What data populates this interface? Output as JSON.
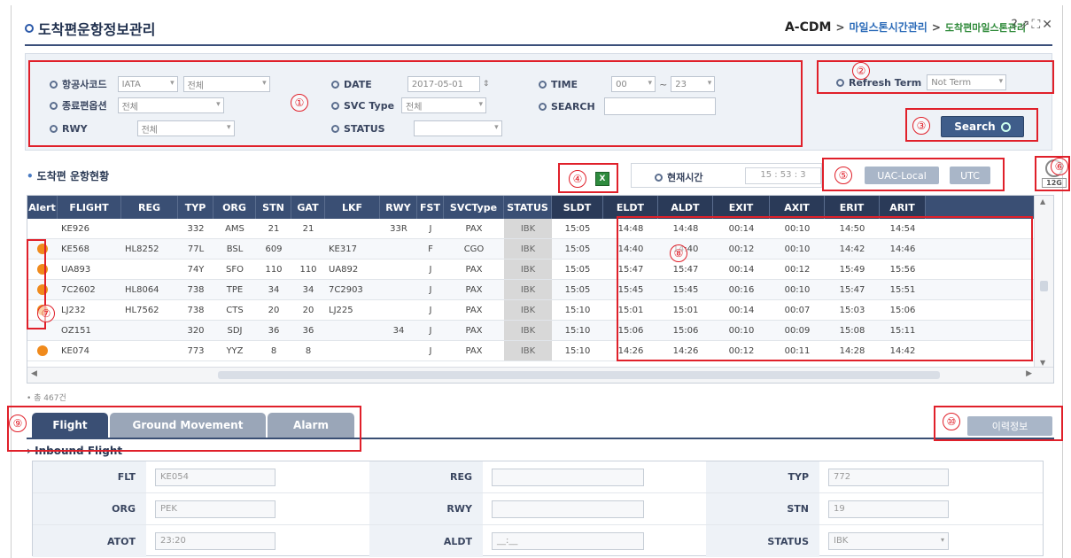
{
  "header": {
    "title": "도착편운항정보관리",
    "crumb_root": "A-CDM",
    "crumb_mid": "마일스톤시간관리",
    "crumb_leaf": "도착편마일스톤관리",
    "separator": ">",
    "icons": [
      "help-icon",
      "popout-icon",
      "fullscreen-icon",
      "close-icon"
    ],
    "icon_glyphs": [
      "?",
      "⇗",
      "⛶",
      "✕"
    ]
  },
  "search": {
    "airline_label": "항공사코드",
    "airline_code_type": "IATA",
    "airline_value": "전체",
    "date_label": "DATE",
    "date_value": "2017-05-01",
    "time_label": "TIME",
    "time_from": "00",
    "time_sep": "~",
    "time_to": "23",
    "refresh_label": "Refresh Term",
    "refresh_value": "Not Term",
    "end_option_label": "종료편옵션",
    "end_option_value": "전체",
    "svc_type_label": "SVC Type",
    "svc_type_value": "전체",
    "search_label": "SEARCH",
    "search_value": "",
    "rwy_label": "RWY",
    "rwy_value": "전체",
    "status_label": "STATUS",
    "status_value": "",
    "search_button": "Search"
  },
  "status_section": {
    "title": "도착편 운항현황",
    "excel_icon": "excel-icon",
    "current_time_label": "현재시간",
    "current_time_value": "15 : 53 : 3",
    "local_button": "UAC-Local",
    "utc_button": "UTC",
    "clock_badge": "12G"
  },
  "annotations": [
    "①",
    "②",
    "③",
    "④",
    "⑤",
    "⑥",
    "⑦",
    "⑧",
    "⑨",
    "⑩"
  ],
  "table": {
    "headers": [
      "Alert",
      "FLIGHT",
      "REG",
      "TYP",
      "ORG",
      "STN",
      "GAT",
      "LKF",
      "RWY",
      "FST",
      "SVCType",
      "STATUS",
      "SLDT",
      "ELDT",
      "ALDT",
      "EXIT",
      "AXIT",
      "ERIT",
      "ARIT"
    ],
    "rows": [
      {
        "alert": false,
        "flight": "KE926",
        "reg": "",
        "typ": "332",
        "org": "AMS",
        "stn": "21",
        "gat": "21",
        "lkf": "",
        "rwy": "33R",
        "fst": "J",
        "svc": "PAX",
        "status": "IBK",
        "sldt": "15:05",
        "eldt": "14:48",
        "aldt": "14:48",
        "exit": "00:14",
        "axit": "00:10",
        "erit": "14:50",
        "arit": "14:54"
      },
      {
        "alert": true,
        "flight": "KE568",
        "reg": "HL8252",
        "typ": "77L",
        "org": "BSL",
        "stn": "609",
        "gat": "",
        "lkf": "KE317",
        "rwy": "",
        "fst": "F",
        "svc": "CGO",
        "status": "IBK",
        "sldt": "15:05",
        "eldt": "14:40",
        "aldt": "14:40",
        "exit": "00:12",
        "axit": "00:10",
        "erit": "14:42",
        "arit": "14:46"
      },
      {
        "alert": true,
        "flight": "UA893",
        "reg": "",
        "typ": "74Y",
        "org": "SFO",
        "stn": "110",
        "gat": "110",
        "lkf": "UA892",
        "rwy": "",
        "fst": "J",
        "svc": "PAX",
        "status": "IBK",
        "sldt": "15:05",
        "eldt": "15:47",
        "aldt": "15:47",
        "exit": "00:14",
        "axit": "00:12",
        "erit": "15:49",
        "arit": "15:56"
      },
      {
        "alert": true,
        "flight": "7C2602",
        "reg": "HL8064",
        "typ": "738",
        "org": "TPE",
        "stn": "34",
        "gat": "34",
        "lkf": "7C2903",
        "rwy": "",
        "fst": "J",
        "svc": "PAX",
        "status": "IBK",
        "sldt": "15:05",
        "eldt": "15:45",
        "aldt": "15:45",
        "exit": "00:16",
        "axit": "00:10",
        "erit": "15:47",
        "arit": "15:51"
      },
      {
        "alert": true,
        "flight": "LJ232",
        "reg": "HL7562",
        "typ": "738",
        "org": "CTS",
        "stn": "20",
        "gat": "20",
        "lkf": "LJ225",
        "rwy": "",
        "fst": "J",
        "svc": "PAX",
        "status": "IBK",
        "sldt": "15:10",
        "eldt": "15:01",
        "aldt": "15:01",
        "exit": "00:14",
        "axit": "00:07",
        "erit": "15:03",
        "arit": "15:06"
      },
      {
        "alert": false,
        "flight": "OZ151",
        "reg": "",
        "typ": "320",
        "org": "SDJ",
        "stn": "36",
        "gat": "36",
        "lkf": "",
        "rwy": "34",
        "fst": "J",
        "svc": "PAX",
        "status": "IBK",
        "sldt": "15:10",
        "eldt": "15:06",
        "aldt": "15:06",
        "exit": "00:10",
        "axit": "00:09",
        "erit": "15:08",
        "arit": "15:11"
      },
      {
        "alert": true,
        "flight": "KE074",
        "reg": "",
        "typ": "773",
        "org": "YYZ",
        "stn": "8",
        "gat": "8",
        "lkf": "",
        "rwy": "",
        "fst": "J",
        "svc": "PAX",
        "status": "IBK",
        "sldt": "15:10",
        "eldt": "14:26",
        "aldt": "14:26",
        "exit": "00:12",
        "axit": "00:11",
        "erit": "14:28",
        "arit": "14:42"
      }
    ],
    "total": "• 총 467건"
  },
  "tabs": {
    "items": [
      "Flight",
      "Ground Movement",
      "Alarm"
    ],
    "active": "Flight",
    "info_button": "이력정보"
  },
  "inbound": {
    "title": "Inbound Flight",
    "flt_label": "FLT",
    "flt_value": "KE054",
    "reg_label": "REG",
    "reg_value": "",
    "typ_label": "TYP",
    "typ_value": "772",
    "org_label": "ORG",
    "org_value": "PEK",
    "rwy_label": "RWY",
    "rwy_value": "",
    "stn_label": "STN",
    "stn_value": "19",
    "atot_label": "ATOT",
    "atot_value": "23:20",
    "aldt_label": "ALDT",
    "aldt_value": "__:__",
    "status_label": "STATUS",
    "status_value": "IBK"
  },
  "colors": {
    "header_bg": "#3a4f74",
    "annotation_red": "#e0202a",
    "alert_orange": "#f08a1c",
    "search_button": "#3f5d8a"
  }
}
